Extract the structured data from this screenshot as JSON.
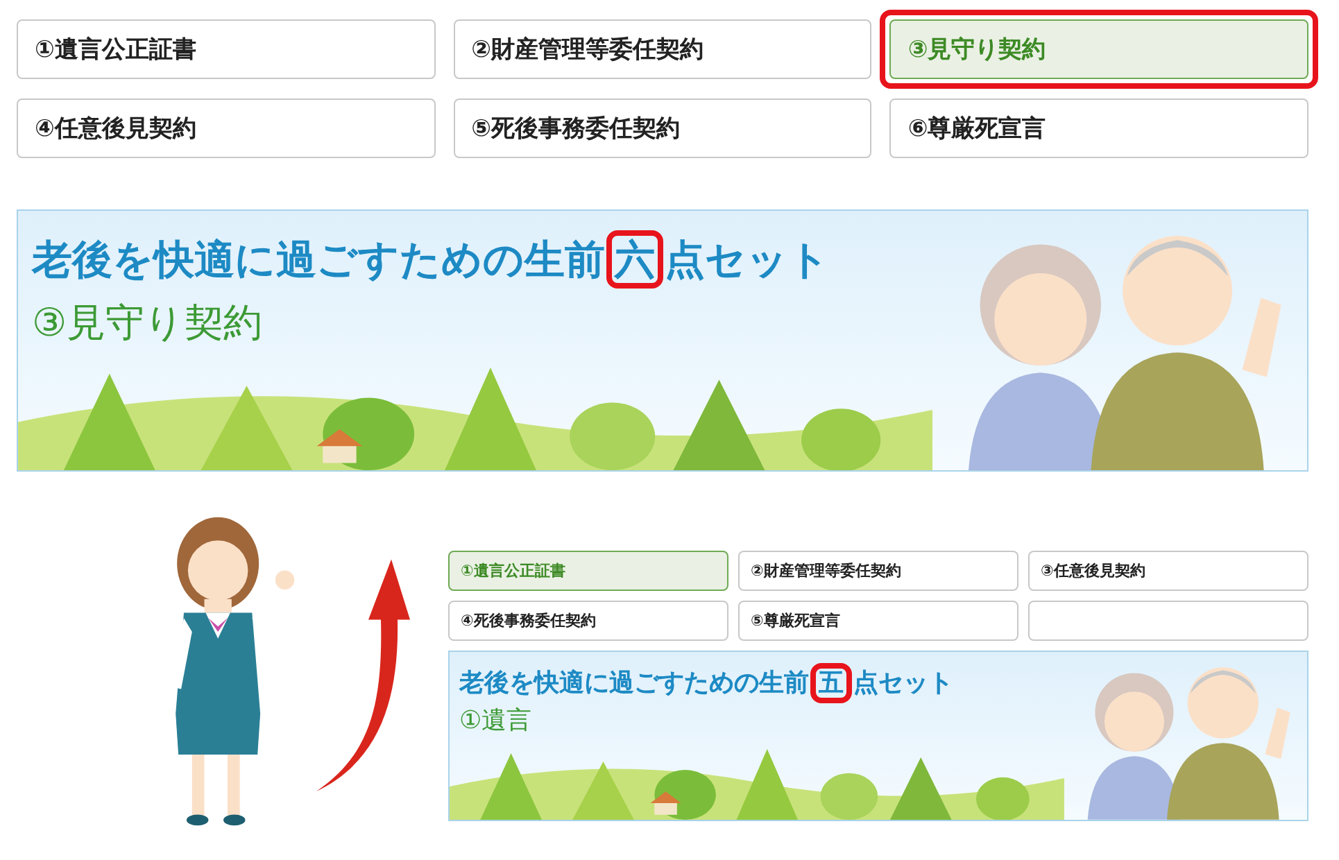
{
  "top": {
    "tabs": [
      {
        "kind": "label",
        "label": "①遺言公正証書",
        "selected": false,
        "highlighted": false
      },
      {
        "kind": "label",
        "label": "②財産管理等委任契約",
        "selected": false,
        "highlighted": false
      },
      {
        "kind": "label",
        "label": "③見守り契約",
        "selected": true,
        "highlighted": true
      },
      {
        "kind": "label",
        "label": "④任意後見契約",
        "selected": false,
        "highlighted": false
      },
      {
        "kind": "label",
        "label": "⑤死後事務委任契約",
        "selected": false,
        "highlighted": false
      },
      {
        "kind": "label",
        "label": "⑥尊厳死宣言",
        "selected": false,
        "highlighted": false
      }
    ],
    "banner": {
      "title": [
        {
          "text": "老後を快適に過ごすための生前",
          "marked": false
        },
        {
          "text": "六",
          "marked": true
        },
        {
          "text": "点セット",
          "marked": false
        }
      ],
      "subtitle": "③見守り契約"
    }
  },
  "bottom": {
    "tabs": [
      {
        "kind": "label",
        "label": "①遺言公正証書",
        "selected": true
      },
      {
        "kind": "label",
        "label": "②財産管理等委任契約",
        "selected": false
      },
      {
        "kind": "label",
        "label": "③任意後見契約",
        "selected": false
      },
      {
        "kind": "label",
        "label": "④死後事務委任契約",
        "selected": false
      },
      {
        "kind": "label",
        "label": "⑤尊厳死宣言",
        "selected": false
      },
      {
        "kind": "blank",
        "selected": false
      }
    ],
    "banner": {
      "title": [
        {
          "text": "老後を快適に過ごすための生前",
          "marked": false
        },
        {
          "text": "五",
          "marked": true
        },
        {
          "text": "点セット",
          "marked": false
        }
      ],
      "subtitle": "①遺言"
    }
  }
}
